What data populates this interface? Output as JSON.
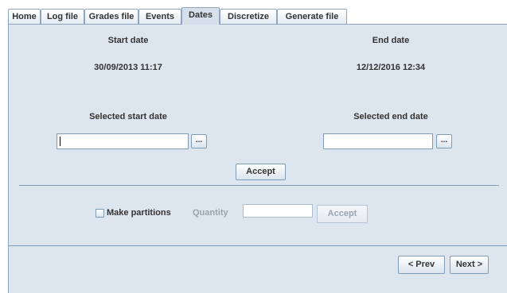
{
  "tabs": [
    {
      "label": "Home"
    },
    {
      "label": "Log file"
    },
    {
      "label": "Grades file"
    },
    {
      "label": "Events"
    },
    {
      "label": "Dates",
      "active": true
    },
    {
      "label": "Discretize"
    },
    {
      "label": "Generate file"
    }
  ],
  "dates": {
    "start_label": "Start date",
    "start_value": "30/09/2013 11:17",
    "end_label": "End date",
    "end_value": "12/12/2016 12:34",
    "selected_start_label": "Selected start date",
    "selected_end_label": "Selected end date",
    "selected_start_value": "",
    "selected_end_value": "",
    "picker_label": "...",
    "accept_label": "Accept"
  },
  "partitions": {
    "checkbox_label": "Make partitions",
    "checked": false,
    "quantity_label": "Quantity",
    "quantity_value": "",
    "accept_label": "Accept"
  },
  "nav": {
    "prev_label": "< Prev",
    "next_label": "Next >"
  }
}
